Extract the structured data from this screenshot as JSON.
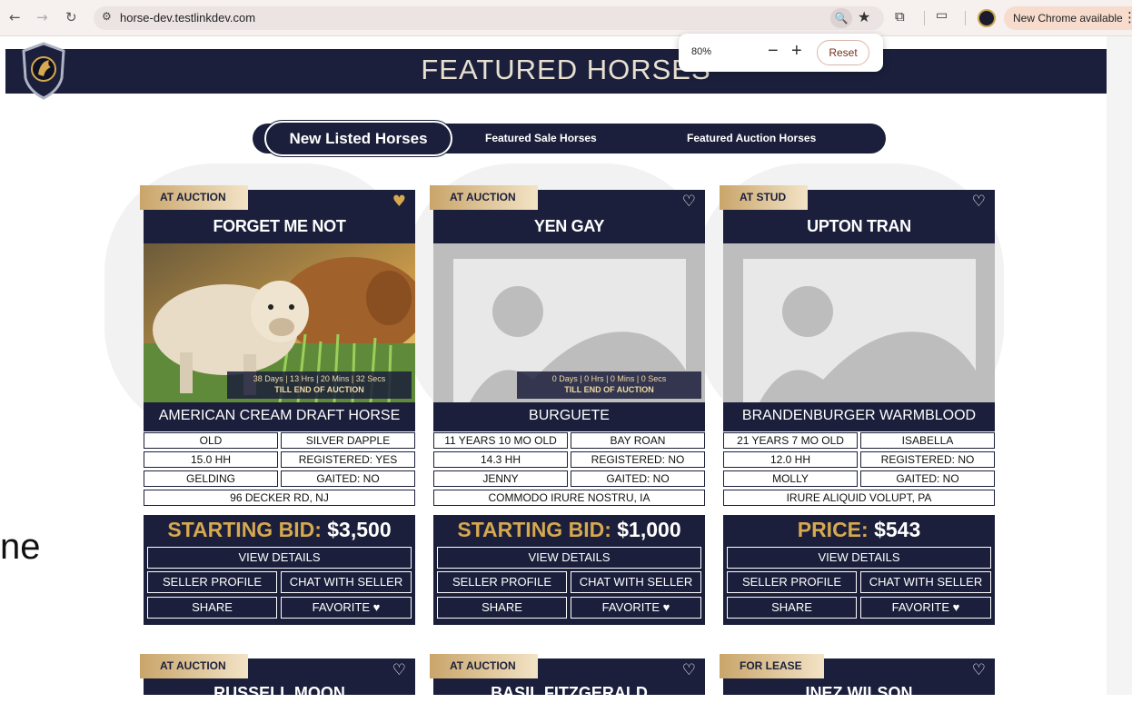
{
  "browser": {
    "url": "horse-dev.testlinkdev.com",
    "new_chrome_label": "New Chrome available",
    "zoom_popup": {
      "percent": "80%",
      "minus": "−",
      "plus": "+",
      "reset": "Reset"
    }
  },
  "header": {
    "title": "FEATURED HORSES"
  },
  "page_fragment": "ne",
  "tabs": [
    "New Listed Horses",
    "Featured Sale Horses",
    "Featured Auction Horses"
  ],
  "timer_suffix": "TILL END OF AUCTION",
  "cards": [
    {
      "badge": "AT AUCTION",
      "favorited": true,
      "name": "FORGET ME NOT",
      "photo": "calf-photo",
      "timer": "38 Days | 13 Hrs | 20 Mins | 32 Secs",
      "breed": "AMERICAN CREAM DRAFT HORSE",
      "age": "OLD",
      "color": "SILVER DAPPLE",
      "height": "15.0 HH",
      "registered": "REGISTERED: YES",
      "sex": "GELDING",
      "gaited": "GAITED: NO",
      "location": "96 DECKER RD, NJ",
      "price_label": "STARTING BID:",
      "price_value": "$3,500"
    },
    {
      "badge": "AT AUCTION",
      "favorited": false,
      "name": "YEN GAY",
      "photo": "placeholder",
      "timer": "0 Days | 0 Hrs | 0 Mins | 0 Secs",
      "breed": "BURGUETE",
      "age": "11 YEARS 10 MO OLD",
      "color": "BAY ROAN",
      "height": "14.3 HH",
      "registered": "REGISTERED: NO",
      "sex": "JENNY",
      "gaited": "GAITED: NO",
      "location": "COMMODO IRURE NOSTRU, IA",
      "price_label": "STARTING BID:",
      "price_value": "$1,000"
    },
    {
      "badge": "AT STUD",
      "favorited": false,
      "name": "UPTON TRAN",
      "photo": "placeholder",
      "timer": "",
      "breed": "BRANDENBURGER WARMBLOOD",
      "age": "21 YEARS 7 MO OLD",
      "color": "ISABELLA",
      "height": "12.0 HH",
      "registered": "REGISTERED: NO",
      "sex": "MOLLY",
      "gaited": "GAITED: NO",
      "location": "IRURE ALIQUID VOLUPT, PA",
      "price_label": "PRICE:",
      "price_value": "$543"
    }
  ],
  "buttons": {
    "view": "VIEW DETAILS",
    "seller": "SELLER PROFILE",
    "chat": "CHAT WITH SELLER",
    "share": "SHARE",
    "favorite": "FAVORITE ♥"
  },
  "next_row": [
    {
      "badge": "AT AUCTION",
      "name": "RUSSELL MOON"
    },
    {
      "badge": "AT AUCTION",
      "name": "BASIL FITZGERALD"
    },
    {
      "badge": "FOR LEASE",
      "name": "INEZ WILSON"
    }
  ],
  "colors": {
    "navy": "#1b1f3b",
    "gold": "#d6a84f"
  }
}
